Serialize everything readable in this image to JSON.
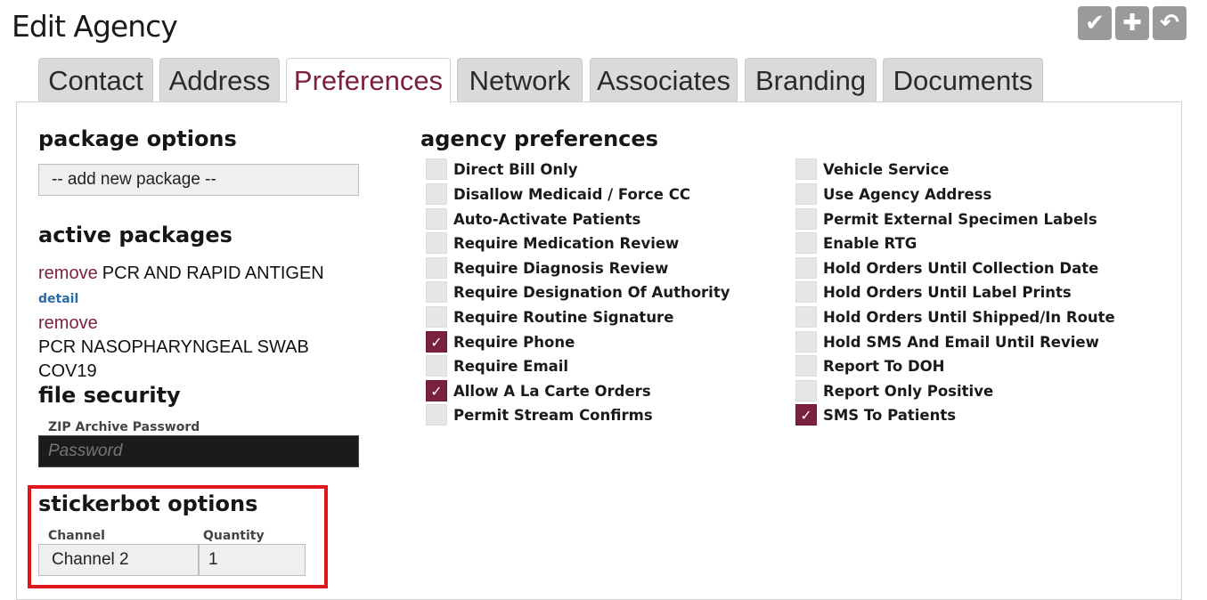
{
  "page": {
    "title": "Edit Agency"
  },
  "toolbar": [
    {
      "name": "save-button",
      "icon": "check-icon",
      "glyph": "✔"
    },
    {
      "name": "add-button",
      "icon": "plus-icon",
      "glyph": "✚"
    },
    {
      "name": "back-button",
      "icon": "undo-icon",
      "glyph": "↶"
    }
  ],
  "tabs": [
    {
      "label": "Contact",
      "active": false
    },
    {
      "label": "Address",
      "active": false
    },
    {
      "label": "Preferences",
      "active": true
    },
    {
      "label": "Network",
      "active": false
    },
    {
      "label": "Associates",
      "active": false
    },
    {
      "label": "Branding",
      "active": false
    },
    {
      "label": "Documents",
      "active": false
    }
  ],
  "package_options": {
    "heading": "package options",
    "select_value": "-- add new package --"
  },
  "active_packages": {
    "heading": "active packages",
    "remove_label": "remove",
    "detail_label": "detail",
    "items": [
      {
        "name": "PCR AND RAPID ANTIGEN",
        "has_detail": true
      },
      {
        "name": "PCR NASOPHARYNGEAL SWAB COV19",
        "has_detail": false
      }
    ]
  },
  "file_security": {
    "heading": "file security",
    "zip_label": "ZIP Archive Password",
    "password_placeholder": "Password"
  },
  "stickerbot": {
    "heading": "stickerbot options",
    "channel_label": "Channel",
    "channel_value": "Channel 2",
    "quantity_label": "Quantity",
    "quantity_value": "1"
  },
  "agency_preferences": {
    "heading": "agency preferences",
    "column1": [
      {
        "label": "Direct Bill Only",
        "checked": false
      },
      {
        "label": "Disallow Medicaid / Force CC",
        "checked": false
      },
      {
        "label": "Auto-Activate Patients",
        "checked": false
      },
      {
        "label": "Require Medication Review",
        "checked": false
      },
      {
        "label": "Require Diagnosis Review",
        "checked": false
      },
      {
        "label": "Require Designation Of Authority",
        "checked": false
      },
      {
        "label": "Require Routine Signature",
        "checked": false
      },
      {
        "label": "Require Phone",
        "checked": true
      },
      {
        "label": "Require Email",
        "checked": false
      },
      {
        "label": "Allow A La Carte Orders",
        "checked": true
      },
      {
        "label": "Permit Stream Confirms",
        "checked": false
      }
    ],
    "column2": [
      {
        "label": "Vehicle Service",
        "checked": false
      },
      {
        "label": "Use Agency Address",
        "checked": false
      },
      {
        "label": "Permit External Specimen Labels",
        "checked": false
      },
      {
        "label": "Enable RTG",
        "checked": false
      },
      {
        "label": "Hold Orders Until Collection Date",
        "checked": false
      },
      {
        "label": "Hold Orders Until Label Prints",
        "checked": false
      },
      {
        "label": "Hold Orders Until Shipped/In Route",
        "checked": false
      },
      {
        "label": "Hold SMS And Email Until Review",
        "checked": false
      },
      {
        "label": "Report To DOH",
        "checked": false
      },
      {
        "label": "Report Only Positive",
        "checked": false
      },
      {
        "label": "SMS To Patients",
        "checked": true
      }
    ]
  },
  "colors": {
    "accent": "#7a2040",
    "highlight_box": "#e0161e",
    "link_blue": "#2a6aa8"
  }
}
